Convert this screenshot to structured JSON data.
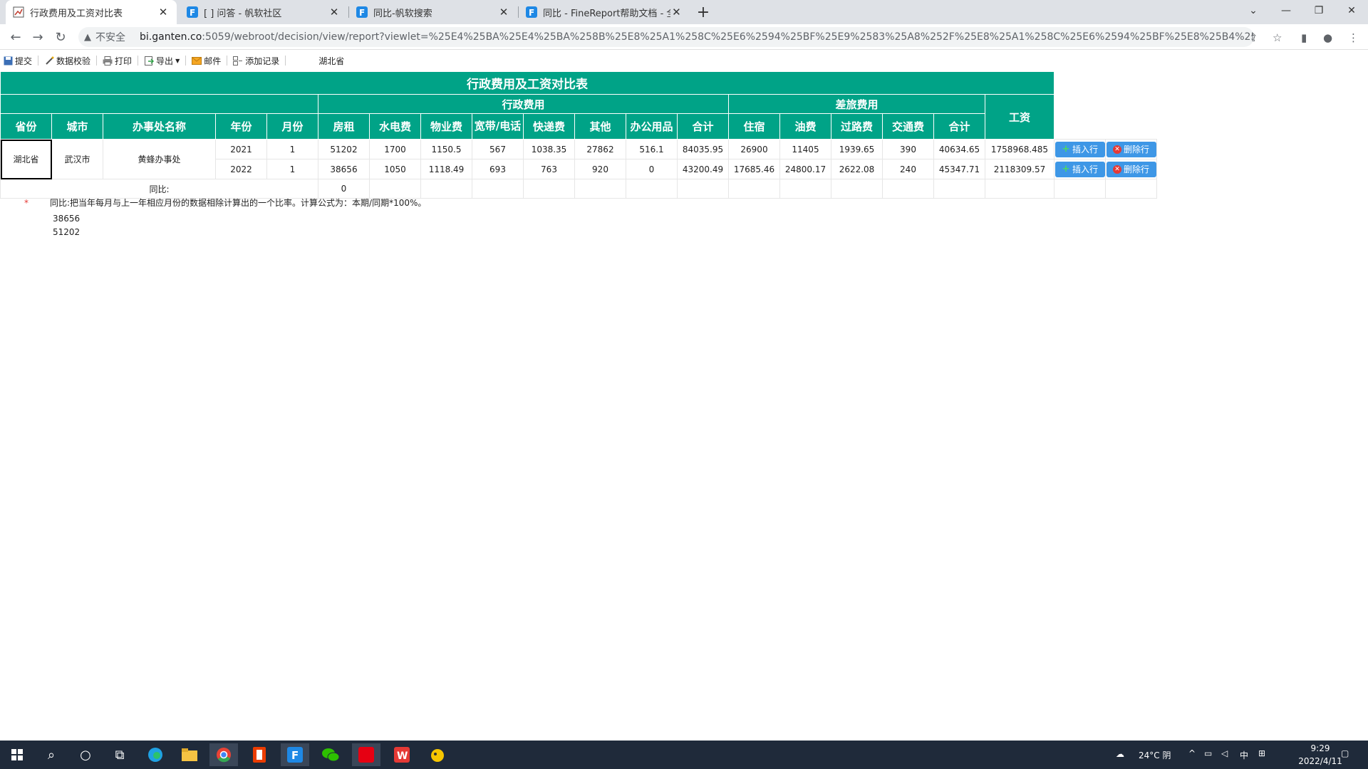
{
  "browser": {
    "tabs": [
      {
        "title": "行政费用及工资对比表",
        "active": true
      },
      {
        "title": "[        ] 问答 - 帆软社区",
        "active": false
      },
      {
        "title": "同比-帆软搜索",
        "active": false
      },
      {
        "title": "同比 - FineReport帮助文档 - 全",
        "active": false
      }
    ],
    "insecure_label": "不安全",
    "url_host": "bi.ganten.co",
    "url_path": ":5059/webroot/decision/view/report?viewlet=%25E4%25BA%25E4%25BA%258B%25E8%25A1%258C%25E6%2594%25BF%25E9%2583%25A8%252F%25E8%25A1%258C%25E6%2594%25BF%25E8%25B4%25B..."
  },
  "report_toolbar": {
    "submit": "提交",
    "validate": "数据校验",
    "print": "打印",
    "export": "导出",
    "mail": "邮件",
    "add_record": "添加记录",
    "province_param": "湖北省"
  },
  "report": {
    "title": "行政费用及工资对比表",
    "group_admin": "行政费用",
    "group_travel": "差旅费用",
    "headers": {
      "province": "省份",
      "city": "城市",
      "office": "办事处名称",
      "year": "年份",
      "month": "月份",
      "rent": "房租",
      "utility": "水电费",
      "property": "物业费",
      "broadband": "宽带/电话",
      "express": "快递费",
      "other": "其他",
      "office_supplies": "办公用品",
      "admin_total": "合计",
      "lodging": "住宿",
      "fuel": "油费",
      "toll": "过路费",
      "transport": "交通费",
      "travel_total": "合计",
      "salary": "工资"
    },
    "province": "湖北省",
    "city": "武汉市",
    "office": "黄蜂办事处",
    "rows": [
      {
        "year": "2021",
        "month": "1",
        "rent": "51202",
        "utility": "1700",
        "property": "1150.5",
        "broadband": "567",
        "express": "1038.35",
        "other": "27862",
        "office_supplies": "516.1",
        "admin_total": "84035.95",
        "lodging": "26900",
        "fuel": "11405",
        "toll": "1939.65",
        "transport": "390",
        "travel_total": "40634.65",
        "salary": "1758968.485"
      },
      {
        "year": "2022",
        "month": "1",
        "rent": "38656",
        "utility": "1050",
        "property": "1118.49",
        "broadband": "693",
        "express": "763",
        "other": "920",
        "office_supplies": "0",
        "admin_total": "43200.49",
        "lodging": "17685.46",
        "fuel": "24800.17",
        "toll": "2622.08",
        "transport": "240",
        "travel_total": "45347.71",
        "salary": "2118309.57"
      }
    ],
    "yoy_label": "同比:",
    "yoy_rent": "0",
    "insert_row": "插入行",
    "delete_row": "删除行"
  },
  "note": {
    "star": "*",
    "text": "同比:把当年每月与上一年相应月份的数据相除计算出的一个比率。计算公式为：本期/同期*100%。",
    "line1": "38656",
    "line2": "51202"
  },
  "taskbar": {
    "weather": "24°C 阴",
    "ime": "中",
    "time": "9:29",
    "date": "2022/4/11"
  },
  "colors": {
    "header_green": "#00a387",
    "button_blue": "#3e97e6"
  }
}
